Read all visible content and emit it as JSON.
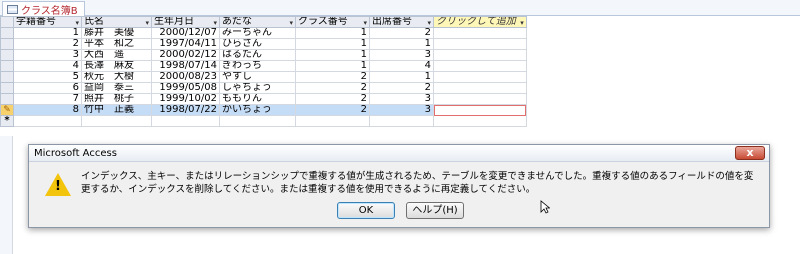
{
  "tab": {
    "label": "クラス名簿B"
  },
  "columns": [
    "学籍番号",
    "氏名",
    "生年月日",
    "あだな",
    "クラス番号",
    "出席番号",
    "クリックして追加"
  ],
  "rows": [
    [
      "1",
      "藤井　美優",
      "2000/12/07",
      "みーちゃん",
      "1",
      "2"
    ],
    [
      "2",
      "平本　和之",
      "1997/04/11",
      "ひらさん",
      "1",
      "1"
    ],
    [
      "3",
      "大西　遥",
      "2000/02/12",
      "はるたん",
      "1",
      "3"
    ],
    [
      "4",
      "長澤　麻友",
      "1998/07/14",
      "ぎわっち",
      "1",
      "4"
    ],
    [
      "5",
      "秋元　大樹",
      "2000/08/23",
      "やすし",
      "2",
      "1"
    ],
    [
      "6",
      "益岡　泰三",
      "1999/05/08",
      "しゃちょう",
      "2",
      "2"
    ],
    [
      "7",
      "照井　桃子",
      "1999/10/02",
      "ももりん",
      "2",
      "3"
    ],
    [
      "8",
      "竹中　正義",
      "1998/07/22",
      "かいちょう",
      "2",
      "3"
    ]
  ],
  "dialog": {
    "title": "Microsoft Access",
    "close": "x",
    "message": "インデックス、主キー、またはリレーションシップで重複する値が生成されるため、テーブルを変更できませんでした。重複する値のあるフィールドの値を変更するか、インデックスを削除してください。または重複する値を使用できるように再定義してください。",
    "warning_mark": "!",
    "ok": "OK",
    "help": "ヘルプ(H)"
  },
  "icons": {
    "current_record": "pencil-icon",
    "new_record": "asterisk-icon",
    "warning": "warning-icon"
  },
  "glyphs": {
    "pencil": "✎",
    "star": "*",
    "arrow": "▾"
  },
  "colors": {
    "tab_text": "#b3262d",
    "selected_row": "#c5dcf6",
    "add_column": "#fff7b8",
    "close_button": "#c74a33",
    "warning": "#f2c40c"
  }
}
